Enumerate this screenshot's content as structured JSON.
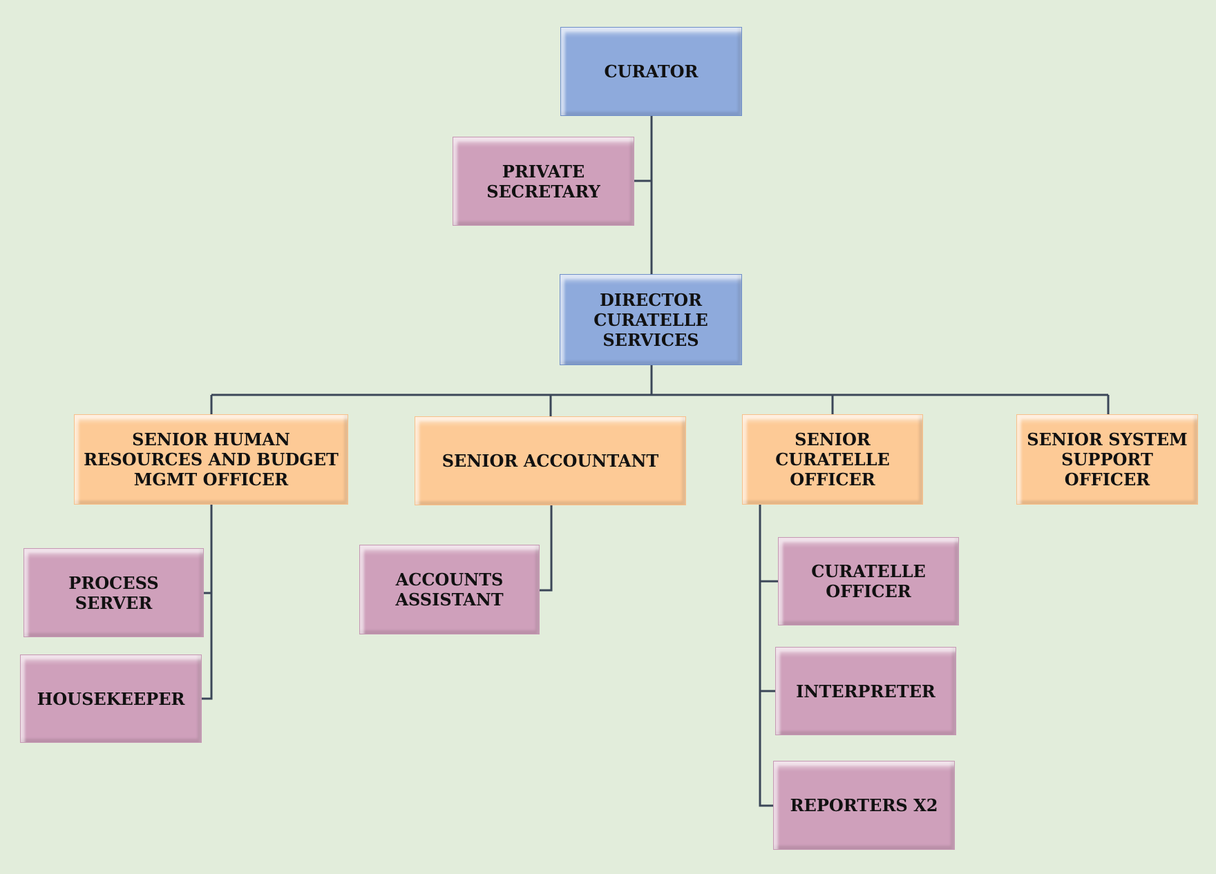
{
  "colors": {
    "background": "#e2eddb",
    "executive": "#8eaadc",
    "senior": "#fdca96",
    "support": "#cfa0bb",
    "connector": "#3b4658"
  },
  "nodes": {
    "curator": "CURATOR",
    "private_secretary": "PRIVATE\nSECRETARY",
    "director": "DIRECTOR\nCURATELLE\nSERVICES",
    "senior_hr": "SENIOR HUMAN\nRESOURCES AND BUDGET\nMGMT OFFICER",
    "senior_accountant": "SENIOR ACCOUNTANT",
    "senior_curatelle": "SENIOR\nCURATELLE\nOFFICER",
    "senior_system": "SENIOR SYSTEM\nSUPPORT\nOFFICER",
    "process_server": "PROCESS\nSERVER",
    "housekeeper": "HOUSEKEEPER",
    "accounts_assistant": "ACCOUNTS\nASSISTANT",
    "curatelle_officer": "CURATELLE\nOFFICER",
    "interpreter": "INTERPRETER",
    "reporters": "REPORTERS X2"
  }
}
